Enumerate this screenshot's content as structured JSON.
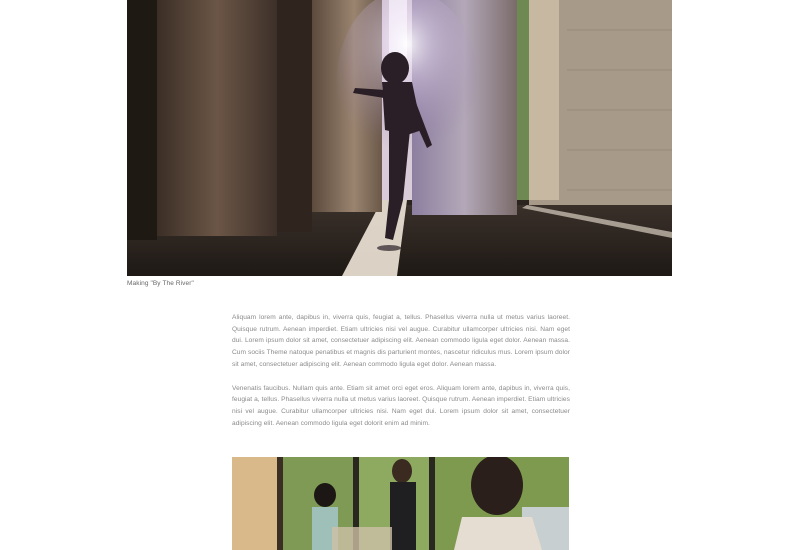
{
  "hero_image": {
    "description_icon": "photo-dancer-hall"
  },
  "caption": "Making \"By The River\"",
  "paragraphs": [
    "Aliquam lorem ante, dapibus in, viverra quis, feugiat a, tellus. Phasellus viverra nulla ut metus varius laoreet. Quisque rutrum. Aenean imperdiet. Etiam ultricies nisi vel augue. Curabitur ullamcorper ultricies nisi. Nam eget dui. Lorem ipsum dolor sit amet, consectetuer adipiscing elit. Aenean commodo ligula eget dolor. Aenean massa. Cum sociis Theme natoque penatibus et magnis dis parturient montes, nascetur ridiculus mus. Lorem ipsum dolor sit amet, consectetuer adipiscing elit. Aenean commodo ligula eget dolor. Aenean massa.",
    "Venenatis faucibus. Nullam quis ante. Etiam sit amet orci eget eros. Aliquam lorem ante, dapibus in, viverra quis, feugiat a, tellus. Phasellus viverra nulla ut metus varius laoreet. Quisque rutrum. Aenean imperdiet. Etiam ultricies nisi vel augue. Curabitur ullamcorper ultricies nisi. Nam eget dui. Lorem ipsum dolor sit amet, consectetuer adipiscing elit. Aenean commodo ligula eget dolorit enim ad minim."
  ],
  "second_image": {
    "description_icon": "photo-people-room"
  }
}
